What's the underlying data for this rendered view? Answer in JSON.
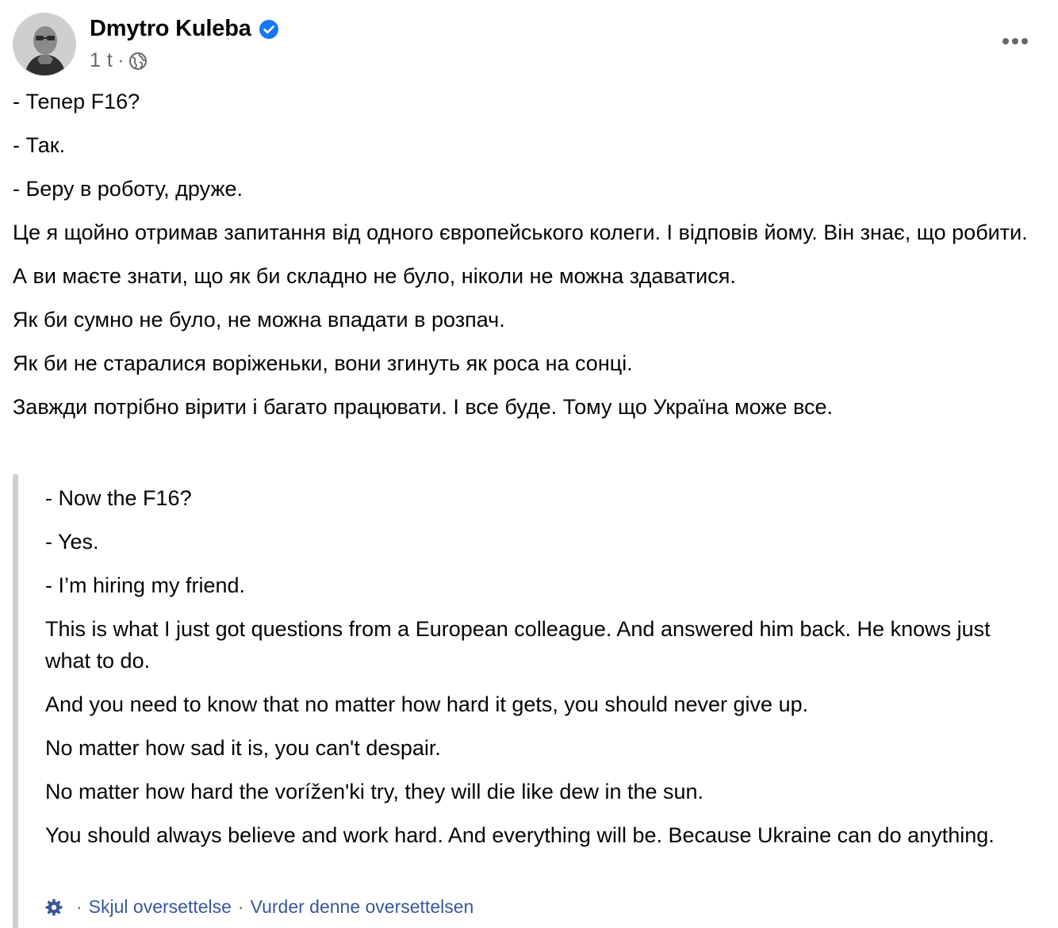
{
  "post": {
    "author": "Dmytro Kuleba",
    "time": "1 t",
    "meta_separator": "·",
    "paragraphs": [
      "- Тепер F16?",
      "- Так.",
      "- Беру в роботу, друже.",
      "Це я щойно отримав запитання від одного європейського колеги. І відповів йому. Він знає, що робити.",
      "А ви маєте знати, що як би складно не було, ніколи не можна здаватися.",
      "Як би сумно не було, не можна впадати в розпач.",
      "Як би не старалися воріженьки, вони згинуть як роса на сонці.",
      "Завжди потрібно вірити і багато працювати. І все буде. Тому що Україна може все."
    ]
  },
  "translation": {
    "paragraphs": [
      "- Now the F16?",
      "- Yes.",
      "- I’m hiring my friend.",
      "This is what I just got questions from a European colleague. And answered him back. He knows just what to do.",
      "And you need to know that no matter how hard it gets, you should never give up.",
      "No matter how sad it is, you can't despair.",
      "No matter how hard the voríženʹki try, they will die like dew in the sun.",
      "You should always believe and work hard. And everything will be. Because Ukraine can do anything."
    ],
    "separator": "·",
    "hide_label": "Skjul oversettelse",
    "rate_label": "Vurder denne oversettelsen"
  },
  "icons": {
    "verified": "verified-badge-icon",
    "audience": "globe-icon",
    "more": "more-horizontal-icon",
    "settings": "gear-icon"
  },
  "colors": {
    "link": "#385898",
    "verified": "#1877f2",
    "secondary_text": "#65676b",
    "quote_bar": "#ccd0d5"
  }
}
